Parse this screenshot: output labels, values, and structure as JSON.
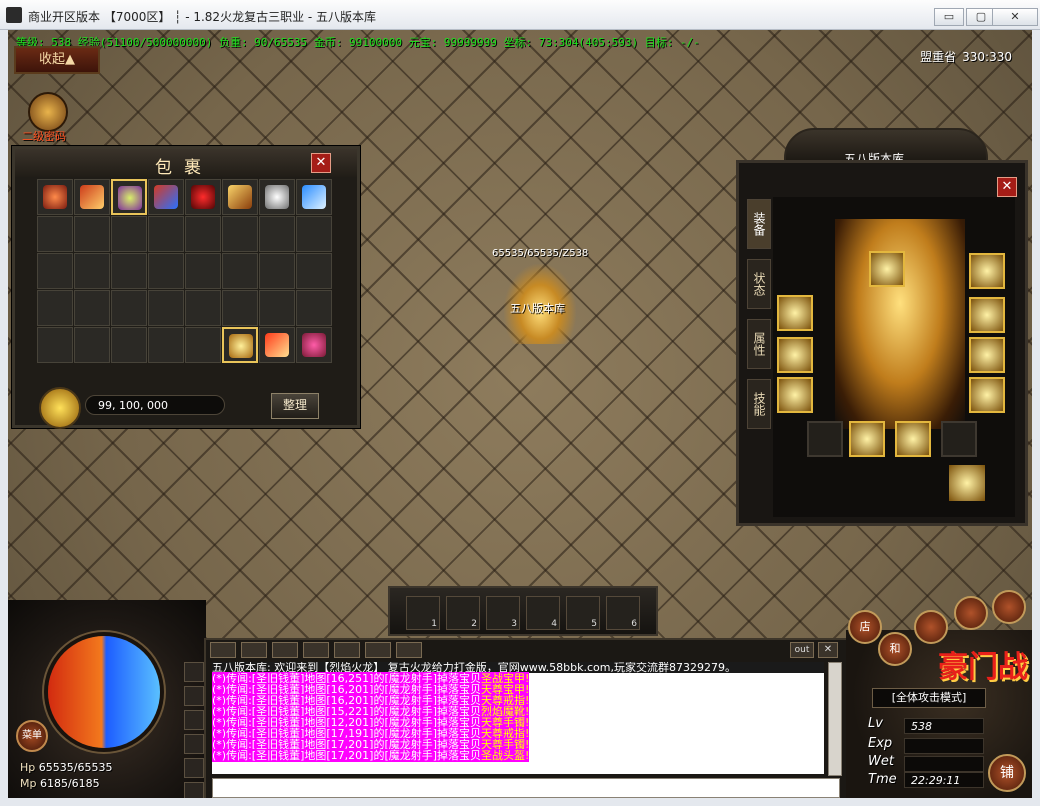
{
  "window": {
    "title": "商业开区版本 【7000区】 ┆ - 1.82火龙复古三职业 - 五八版本库",
    "min_label": "▭",
    "max_label": "▢",
    "close_label": "✕"
  },
  "status_bar": {
    "text": "等级: 538 经验(51100/500000000) 负重: 90/65535 金币: 99100000 元宝: 99999999 坐标: 73:304(405:593) 目标: -/-"
  },
  "map": {
    "name": "盟重省",
    "coords": "330:330"
  },
  "top_left": {
    "collapse_label": "收起▲",
    "password_label": "二级密码"
  },
  "bag": {
    "title": "包裹",
    "close_label": "✕",
    "gold": "99, 100, 000",
    "sort_label": "整理"
  },
  "player": {
    "stats": "65535/65535/Z538",
    "name": "五八版本库"
  },
  "equipment": {
    "title": "五八版本库",
    "close_label": "✕",
    "tabs": [
      "装备",
      "状态",
      "属性",
      "技能"
    ]
  },
  "skills": {
    "slots": [
      "1",
      "2",
      "3",
      "4",
      "5",
      "6"
    ]
  },
  "chat": {
    "out_label": "out",
    "close_label": "✕",
    "system": "五八版本库: 欢迎来到【烈焰火龙】 复古火龙给力打金版，官网www.58bbk.com,玩家交流群87329279。",
    "messages": [
      {
        "a": "(*)传闻:[圣旧钱董]地图[16,251]的[魔龙射手]掉落宝贝",
        "b": "圣战宝甲!"
      },
      {
        "a": "(*)传闻:[圣旧钱董]地图[16,201]的[魔龙射手]掉落宝贝",
        "b": "天尊宝甲!"
      },
      {
        "a": "(*)传闻:[圣旧钱董]地图[16,201]的[魔龙射手]掉落宝贝",
        "b": "天尊戒指!"
      },
      {
        "a": "(*)传闻:[圣旧钱董]地图[15,221]的[魔龙射手]掉落宝贝",
        "b": "烈焰魔靴!"
      },
      {
        "a": "(*)传闻:[圣旧钱董]地图[12,201]的[魔龙射手]掉落宝贝",
        "b": "天尊手镯!"
      },
      {
        "a": "(*)传闻:[圣旧钱董]地图[17,191]的[魔龙射手]掉落宝贝",
        "b": "天尊戒指!"
      },
      {
        "a": "(*)传闻:[圣旧钱董]地图[17,201]的[魔龙射手]掉落宝贝",
        "b": "天尊手镯!"
      },
      {
        "a": "(*)传闻:[圣旧钱董]地图[17,201]的[魔龙射手]掉落宝贝",
        "b": "圣战头盔!"
      }
    ]
  },
  "hud": {
    "menu_label": "菜单",
    "hp_label": "Hp",
    "hp": "65535/65535",
    "mp_label": "Mp",
    "mp": "6185/6185"
  },
  "right_hud": {
    "logo": "豪门战",
    "mode": "[全体攻击模式]",
    "lv_label": "Lv",
    "lv": "538",
    "exp_label": "Exp",
    "wet_label": "Wet",
    "time_label": "Tme",
    "time": "22:29:11",
    "shop_label": "店",
    "pk_label": "和",
    "shop2_label": "铺"
  }
}
